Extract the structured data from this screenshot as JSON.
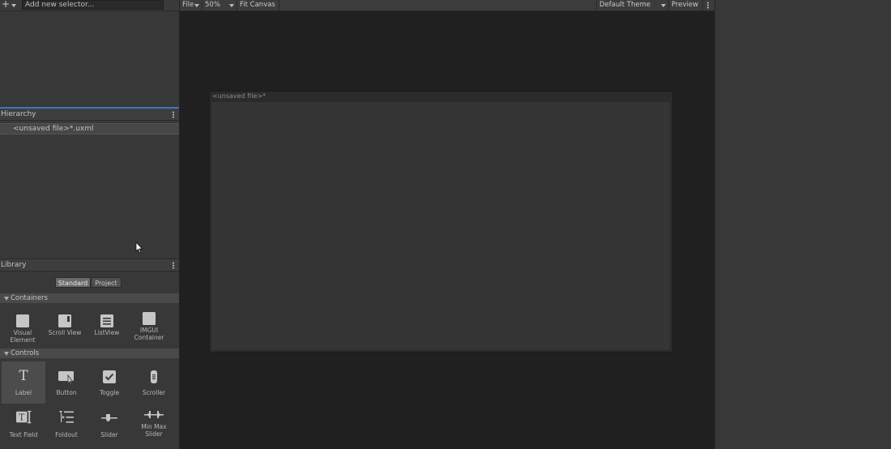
{
  "selectors": {
    "add_icon": "plus-icon",
    "input_value": "Add new selector..."
  },
  "hierarchy": {
    "title": "Hierarchy",
    "items": [
      {
        "label": "<unsaved file>*.uxml"
      }
    ]
  },
  "library": {
    "title": "Library",
    "tabs": [
      {
        "label": "Standard",
        "active": true
      },
      {
        "label": "Project",
        "active": false
      }
    ],
    "categories": [
      {
        "name": "Containers",
        "items": [
          {
            "label": "Visual Element",
            "icon": "visual-element-icon"
          },
          {
            "label": "Scroll View",
            "icon": "scroll-view-icon"
          },
          {
            "label": "ListView",
            "icon": "list-view-icon"
          },
          {
            "label": "IMGUI Container",
            "icon": "imgui-container-icon"
          }
        ]
      },
      {
        "name": "Controls",
        "items": [
          {
            "label": "Label",
            "icon": "label-icon",
            "selected": true
          },
          {
            "label": "Button",
            "icon": "button-icon"
          },
          {
            "label": "Toggle",
            "icon": "toggle-icon"
          },
          {
            "label": "Scroller",
            "icon": "scroller-icon"
          },
          {
            "label": "Text Field",
            "icon": "text-field-icon"
          },
          {
            "label": "Foldout",
            "icon": "foldout-icon"
          },
          {
            "label": "Slider",
            "icon": "slider-icon"
          },
          {
            "label": "Min Max Slider",
            "icon": "min-max-slider-icon"
          }
        ]
      }
    ]
  },
  "toolbar": {
    "file": "File",
    "zoom": "50%",
    "fit_canvas": "Fit Canvas",
    "theme": "Default Theme",
    "preview": "Preview"
  },
  "canvas": {
    "title": "<unsaved file>*"
  },
  "colors": {
    "accent": "#3a79bb",
    "viewport": "#202020",
    "panel": "#383838"
  }
}
